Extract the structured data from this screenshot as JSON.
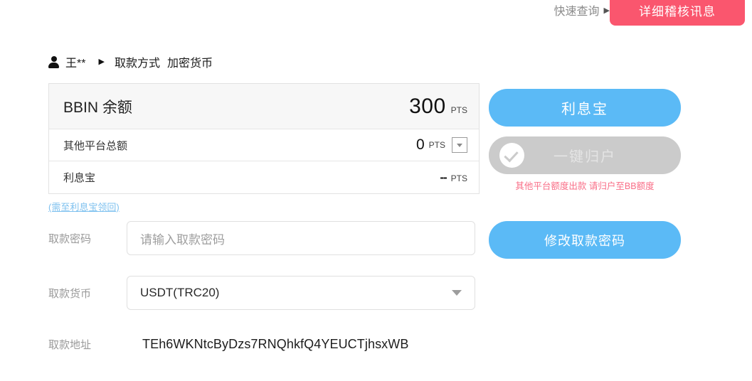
{
  "topbar": {
    "quick_query": "快速查询",
    "quick_query_caret": "▶",
    "detail_tab": "详细稽核讯息",
    "tab_color": "#fa566e"
  },
  "breadcrumb": {
    "user": "王**",
    "arrow": "▶",
    "label": "取款方式",
    "value": "加密货币"
  },
  "balance": {
    "rows": [
      {
        "name": "BBIN 余额",
        "amount": "300",
        "unit": "PTS"
      },
      {
        "name": "其他平台总额",
        "amount": "0",
        "unit": "PTS"
      },
      {
        "name": "利息宝",
        "amount": "--",
        "unit": "PTS"
      }
    ],
    "note_link": "(需至利息宝领回)"
  },
  "form": {
    "password_label": "取款密码",
    "password_value": "",
    "password_placeholder": "请输入取款密码",
    "currency_label": "取款货币",
    "currency_value": "USDT(TRC20)",
    "address_label": "取款地址",
    "address_value": "TEh6WKNtcByDzs7RNQhkfQ4YEUCTjhsxWB"
  },
  "actions": {
    "lixibao": "利息宝",
    "one_click_transfer": "一键归户",
    "transfer_warning": "其他平台额度出款 请归户至BB额度",
    "change_password": "修改取款密码",
    "primary_color": "#5bbaf6",
    "disabled_color": "#cbcbcb",
    "warning_color": "#f96d86"
  }
}
